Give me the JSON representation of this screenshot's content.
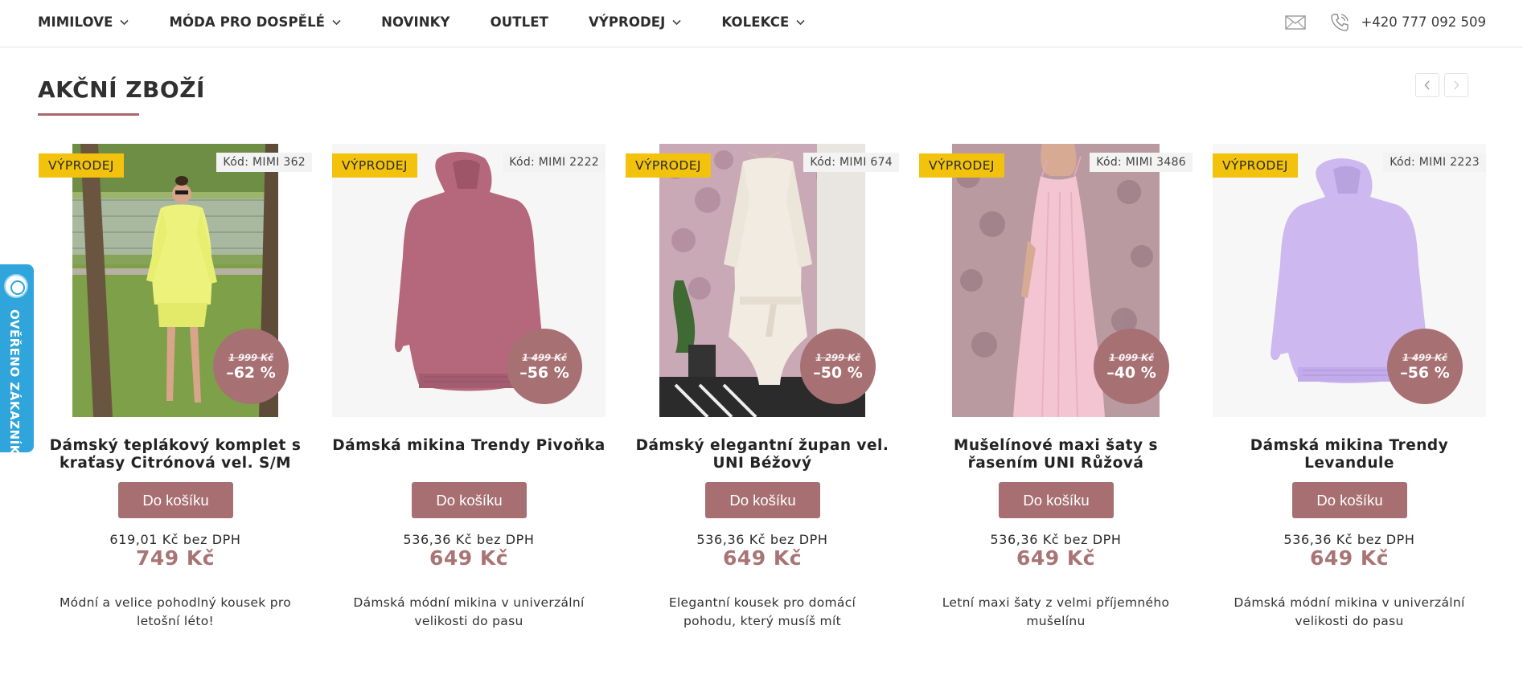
{
  "nav": {
    "items": [
      {
        "label": "MIMILOVE",
        "has_dropdown": true
      },
      {
        "label": "MÓDA PRO DOSPĚLÉ",
        "has_dropdown": true
      },
      {
        "label": "NOVINKY",
        "has_dropdown": false
      },
      {
        "label": "OUTLET",
        "has_dropdown": false
      },
      {
        "label": "VÝPRODEJ",
        "has_dropdown": true
      },
      {
        "label": "KOLEKCE",
        "has_dropdown": true
      }
    ],
    "phone": "+420 777 092 509",
    "mail_icon": "envelope-icon",
    "phone_icon": "phone-icon"
  },
  "section": {
    "title": "AKČNÍ ZBOŽÍ"
  },
  "side_badge": {
    "label": "OVĚŘENO ZÁKAZNÍKY",
    "color": "#2fa5dc"
  },
  "colors": {
    "accent": "#a76f71",
    "sale_tag": "#f2c20c",
    "price": "#a97476"
  },
  "products": [
    {
      "tag": "VÝPRODEJ",
      "code": "Kód: MIMI 362",
      "old_price": "1 999 Kč",
      "discount": "–62 %",
      "name": "Dámský teplákový komplet s kraťasy Citrónová vel. S/M",
      "button": "Do košíku",
      "price_net": "619,01 Kč bez DPH",
      "price": "749 Kč",
      "description": "Módní a velice pohodlný kousek pro letošní léto!"
    },
    {
      "tag": "VÝPRODEJ",
      "code": "Kód: MIMI 2222",
      "old_price": "1 499 Kč",
      "discount": "–56 %",
      "name": "Dámská mikina Trendy Pivoňka",
      "button": "Do košíku",
      "price_net": "536,36 Kč bez DPH",
      "price": "649 Kč",
      "description": "Dámská módní mikina v univerzální velikosti do pasu"
    },
    {
      "tag": "VÝPRODEJ",
      "code": "Kód: MIMI 674",
      "old_price": "1 299 Kč",
      "discount": "–50 %",
      "name": "Dámský elegantní župan vel. UNI Béžový",
      "button": "Do košíku",
      "price_net": "536,36 Kč bez DPH",
      "price": "649 Kč",
      "description": "Elegantní kousek pro domácí pohodu, který musíš mít"
    },
    {
      "tag": "VÝPRODEJ",
      "code": "Kód: MIMI 3486",
      "old_price": "1 099 Kč",
      "discount": "–40 %",
      "name": "Mušelínové maxi šaty s řasením UNI Růžová",
      "button": "Do košíku",
      "price_net": "536,36 Kč bez DPH",
      "price": "649 Kč",
      "description": "Letní maxi šaty z velmi příjemného mušelínu"
    },
    {
      "tag": "VÝPRODEJ",
      "code": "Kód: MIMI 2223",
      "old_price": "1 499 Kč",
      "discount": "–56 %",
      "name": "Dámská mikina Trendy Levandule",
      "button": "Do košíku",
      "price_net": "536,36 Kč bez DPH",
      "price": "649 Kč",
      "description": "Dámská módní mikina v univerzální velikosti do pasu"
    }
  ]
}
